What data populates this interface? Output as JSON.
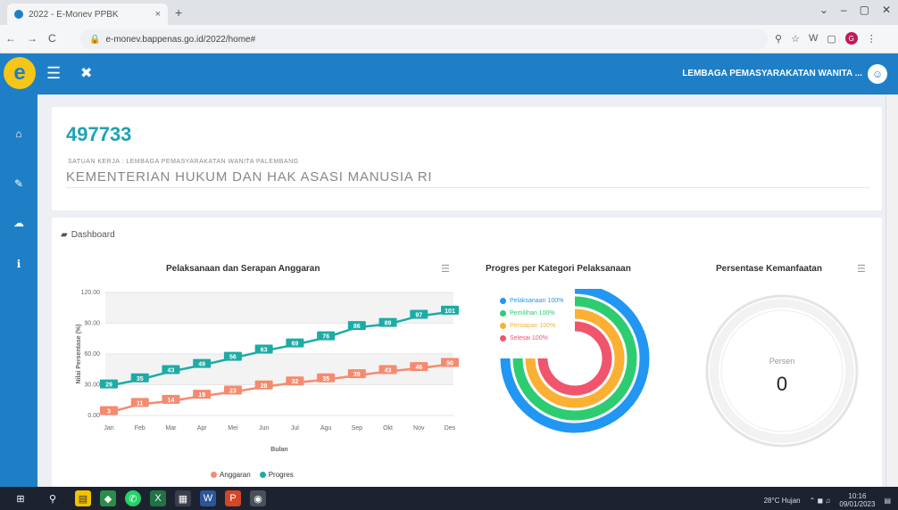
{
  "browser": {
    "tab_title": "2022 - E-Monev PPBK",
    "tab_close": "×",
    "new_tab": "+",
    "window_controls": [
      "⌄",
      "–",
      "▢",
      "✕"
    ],
    "nav": [
      "←",
      "→",
      "C"
    ],
    "url": "e-monev.bappenas.go.id/2022/home#",
    "ext_icons": [
      "⚲",
      "☆",
      "W",
      "▢"
    ],
    "profile_initial": "G",
    "menu": "⋮"
  },
  "header": {
    "logo_letter": "e",
    "menu_icon": "☰",
    "expand_icon": "✖",
    "user_name": "LEMBAGA PEMASYARAKATAN WANITA ...",
    "avatar_icon": "☺"
  },
  "sidebar": {
    "items": [
      {
        "icon": "home-icon",
        "glyph": "⌂"
      },
      {
        "icon": "pencil-icon",
        "glyph": "✎"
      },
      {
        "icon": "cloud-icon",
        "glyph": "☁"
      },
      {
        "icon": "info-icon",
        "glyph": "ℹ"
      }
    ]
  },
  "info_card": {
    "code": "497733",
    "satker_label": "SATUAN KERJA : LEMBAGA PEMASYARAKATAN WANITA PALEMBANG",
    "kementerian": "KEMENTERIAN HUKUM DAN HAK ASASI MANUSIA RI"
  },
  "dashboard": {
    "title": "Dashboard",
    "folder_icon": "▰"
  },
  "chart_data": [
    {
      "type": "line",
      "title": "Pelaksanaan dan Serapan Anggaran",
      "xlabel": "Bulan",
      "ylabel": "Nilai Persentase (%)",
      "categories": [
        "Jan",
        "Feb",
        "Mar",
        "Apr",
        "Mei",
        "Jun",
        "Jul",
        "Agu",
        "Sep",
        "Okt",
        "Nov",
        "Des"
      ],
      "ylim": [
        0,
        120
      ],
      "yticks": [
        "0.00",
        "30.00",
        "60.00",
        "90.00",
        "120.00"
      ],
      "series": [
        {
          "name": "Anggaran",
          "color": "#f58a6f",
          "values": [
            3.0,
            11.0,
            14.0,
            19.0,
            23.0,
            28.0,
            32.0,
            35.0,
            39.0,
            43.0,
            46.0,
            50.0
          ],
          "labels": [
            "3",
            "11",
            "14",
            "19",
            "23",
            "28",
            "32",
            "35",
            "39",
            "43",
            "46",
            "50"
          ]
        },
        {
          "name": "Progres",
          "color": "#1eaba5",
          "values": [
            29.0,
            35.0,
            43.0,
            49.0,
            56.0,
            63.0,
            69.0,
            76.0,
            86.0,
            89.0,
            97.0,
            101.0
          ],
          "labels": [
            "29",
            "35",
            "43",
            "49",
            "56",
            "63",
            "69",
            "76",
            "86",
            "89",
            "97",
            "101"
          ]
        }
      ]
    },
    {
      "type": "radial-bar",
      "title": "Progres per Kategori Pelaksanaan",
      "series": [
        {
          "name": "Pelaksanaan 100%",
          "value": 100,
          "color": "#2196f3"
        },
        {
          "name": "Pemilihan 100%",
          "value": 100,
          "color": "#2ecc71"
        },
        {
          "name": "Persiapan 100%",
          "value": 100,
          "color": "#fbb034"
        },
        {
          "name": "Selesai 100%",
          "value": 100,
          "color": "#f0556d"
        }
      ]
    },
    {
      "type": "gauge",
      "title": "Persentase Kemanfaatan",
      "label": "Persen",
      "value": "0"
    }
  ],
  "menu_icon": "☰",
  "taskbar": {
    "weather": "28°C Hujan",
    "time": "10:16",
    "date": "09/01/2023"
  }
}
